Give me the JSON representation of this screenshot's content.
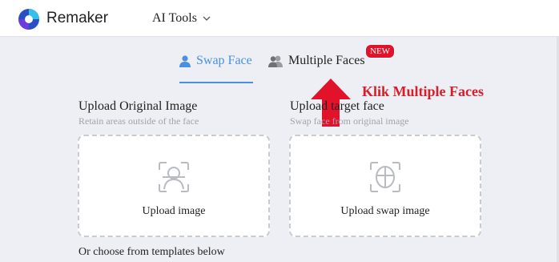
{
  "brand": {
    "name": "Remaker",
    "logo_icon": "remaker-logo-icon"
  },
  "nav": {
    "ai_tools_label": "AI Tools",
    "dropdown_icon": "chevron-down-icon"
  },
  "tabs": {
    "swap_face": {
      "label": "Swap Face",
      "icon": "user-icon",
      "active": true
    },
    "multiple_faces": {
      "label": "Multiple Faces",
      "icon": "users-icon",
      "badge": "NEW"
    }
  },
  "annotation": {
    "text": "Klik Multiple Faces",
    "color": "#d61e2a"
  },
  "upload_original": {
    "title": "Upload Original Image",
    "subtitle": "Retain areas outside of the face",
    "button_label": "Upload image",
    "icon": "face-scan-icon"
  },
  "upload_target": {
    "title": "Upload target face",
    "subtitle": "Swap face from original image",
    "button_label": "Upload swap image",
    "icon": "face-swap-icon"
  },
  "templates_note": "Or choose from templates below",
  "colors": {
    "accent": "#4a90e2",
    "badge": "#e3122b",
    "background": "#eeeff4"
  }
}
